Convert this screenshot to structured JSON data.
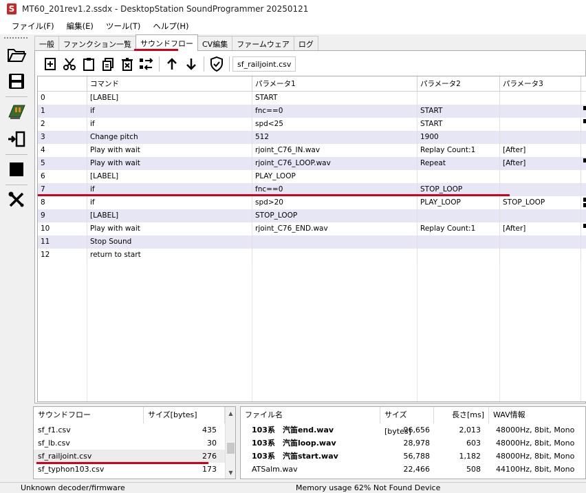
{
  "window": {
    "title": "MT60_201rev1.2.ssdx - DesktopStation SoundProgrammer 20250121",
    "logo": "S"
  },
  "menu": [
    "ファイル(F)",
    "編集(E)",
    "ツール(T)",
    "ヘルプ(H)"
  ],
  "tabs": [
    "一般",
    "ファンクション一覧",
    "サウンドフロー",
    "CV編集",
    "ファームウェア",
    "ログ"
  ],
  "active_tab": "サウンドフロー",
  "flow_toolbar": {
    "file_name": "sf_railjoint.csv"
  },
  "grid": {
    "headers": [
      "コマンド",
      "パラメータ1",
      "パラメータ2",
      "パラメータ3"
    ],
    "rows": [
      {
        "no": "0",
        "cmd": "[LABEL]",
        "p1": "START",
        "p2": "",
        "p3": ""
      },
      {
        "no": "1",
        "cmd": "if",
        "p1": "fnc==0",
        "p2": "START",
        "p3": ""
      },
      {
        "no": "2",
        "cmd": "if",
        "p1": "spd<25",
        "p2": "START",
        "p3": ""
      },
      {
        "no": "3",
        "cmd": "Change pitch",
        "p1": "512",
        "p2": "1900",
        "p3": ""
      },
      {
        "no": "4",
        "cmd": "Play with wait",
        "p1": "rjoint_C76_IN.wav",
        "p2": "Replay Count:1",
        "p3": "[After]"
      },
      {
        "no": "5",
        "cmd": "Play with wait",
        "p1": "rjoint_C76_LOOP.wav",
        "p2": "Repeat",
        "p3": "[After]"
      },
      {
        "no": "6",
        "cmd": "[LABEL]",
        "p1": "PLAY_LOOP",
        "p2": "",
        "p3": ""
      },
      {
        "no": "7",
        "cmd": "if",
        "p1": "fnc==0",
        "p2": "STOP_LOOP",
        "p3": ""
      },
      {
        "no": "8",
        "cmd": "if",
        "p1": "spd>20",
        "p2": "PLAY_LOOP",
        "p3": "STOP_LOOP"
      },
      {
        "no": "9",
        "cmd": "[LABEL]",
        "p1": "STOP_LOOP",
        "p2": "",
        "p3": ""
      },
      {
        "no": "10",
        "cmd": "Play with wait",
        "p1": "rjoint_C76_END.wav",
        "p2": "Replay Count:1",
        "p3": "[After]"
      },
      {
        "no": "11",
        "cmd": "Stop Sound",
        "p1": "",
        "p2": "",
        "p3": ""
      },
      {
        "no": "12",
        "cmd": "return to start",
        "p1": "",
        "p2": "",
        "p3": ""
      }
    ]
  },
  "soundflow_list": {
    "headers": [
      "サウンドフロー",
      "サイズ[bytes]"
    ],
    "items": [
      {
        "name": "sf_f1.csv",
        "size": "435"
      },
      {
        "name": "sf_lb.csv",
        "size": "30"
      },
      {
        "name": "sf_railjoint.csv",
        "size": "276"
      },
      {
        "name": "sf_typhon103.csv",
        "size": "173"
      }
    ]
  },
  "file_list": {
    "headers": [
      "ファイル名",
      "サイズ[bytes]",
      "長さ[ms]",
      "WAV情報"
    ],
    "items": [
      {
        "name": "103系　汽笛end.wav",
        "size": "96,656",
        "len": "2,013",
        "info": "48000Hz, 8bit, Mono"
      },
      {
        "name": "103系　汽笛loop.wav",
        "size": "28,978",
        "len": "603",
        "info": "48000Hz, 8bit, Mono"
      },
      {
        "name": "103系　汽笛start.wav",
        "size": "56,788",
        "len": "1,182",
        "info": "48000Hz, 8bit, Mono"
      },
      {
        "name": "ATSalm.wav",
        "size": "22,466",
        "len": "508",
        "info": "44100Hz, 8bit, Mono"
      }
    ]
  },
  "status": {
    "left": "Unknown decoder/firmware",
    "middle": "Memory usage 62%   Not Found Device"
  },
  "colors": {
    "accent_red": "#d0021b",
    "row_alt": "#e6e6f5"
  }
}
